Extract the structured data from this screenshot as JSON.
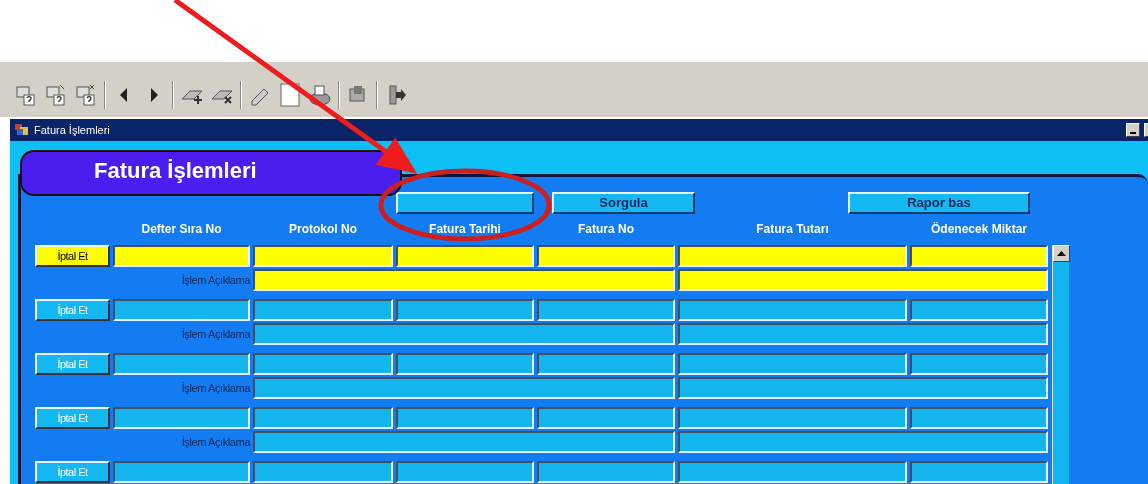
{
  "window": {
    "title": "Fatura İşlemleri"
  },
  "form": {
    "header": "Fatura İşlemleri",
    "buttons": [
      {
        "kind": "blank"
      },
      {
        "kind": "text",
        "label": "Sorgula"
      },
      {
        "kind": "text",
        "label": "Rapor bas"
      }
    ],
    "columns": [
      "Defter Sıra No",
      "Protokol No",
      "Fatura Tarihi",
      "Fatura No",
      "Fatura Tutarı",
      "Ödenecek Miktar"
    ],
    "records": [
      {
        "button": "İptal Et",
        "selected": true,
        "description_label": "İşlem Açıklama"
      },
      {
        "button": "İptal Et",
        "selected": false,
        "description_label": "İşlem Açıklama"
      },
      {
        "button": "İptal Et",
        "selected": false,
        "description_label": "İşlem Açıklama"
      },
      {
        "button": "İptal Et",
        "selected": false,
        "description_label": "İşlem Açıklama"
      },
      {
        "button": "İptal Et",
        "selected": false
      }
    ]
  },
  "annotations": {
    "arrow": true,
    "circle": true
  }
}
